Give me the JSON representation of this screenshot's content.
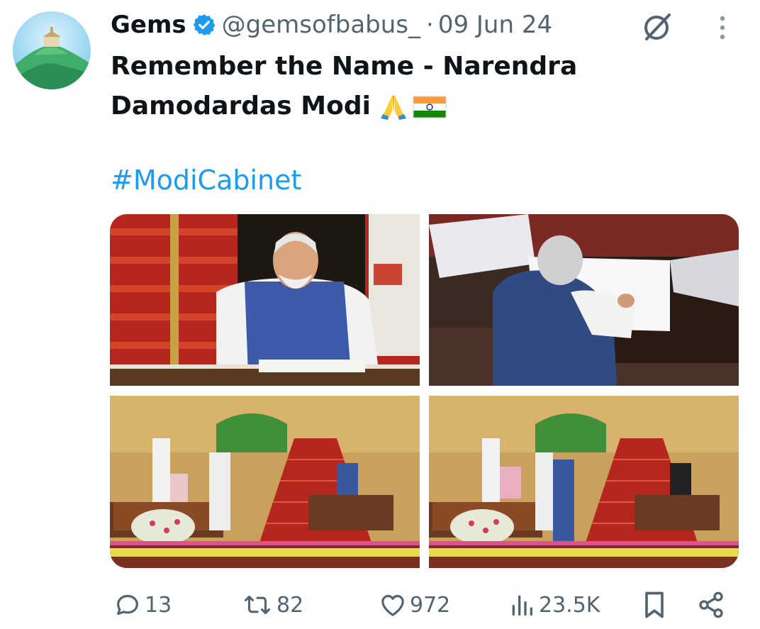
{
  "post": {
    "author_name": "Gems",
    "handle": "@gemsofbabus_",
    "separator": "·",
    "date": "09 Jun 24",
    "text_line1": "Remember the Name - Narendra",
    "text_line2": "Damodardas Modi",
    "hashtag": "#ModiCabinet"
  },
  "media": {
    "photos": [
      {
        "alt": "photo-1"
      },
      {
        "alt": "photo-2"
      },
      {
        "alt": "photo-3"
      },
      {
        "alt": "photo-4"
      }
    ]
  },
  "actions": {
    "replies": "13",
    "reposts": "82",
    "likes": "972",
    "views": "23.5K"
  },
  "icons": [
    "verified-badge-icon",
    "grok-icon",
    "more-icon",
    "reply-icon",
    "repost-icon",
    "like-icon",
    "views-icon",
    "bookmark-icon",
    "share-icon",
    "folded-hands-emoji",
    "india-flag-emoji"
  ],
  "colors": {
    "accent": "#1d9bf0",
    "text": "#0f1419",
    "muted": "#536471"
  }
}
